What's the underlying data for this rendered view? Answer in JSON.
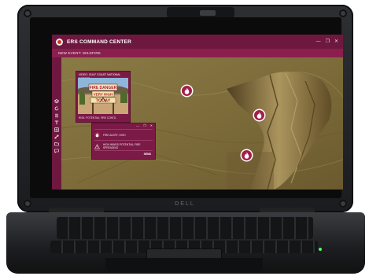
{
  "app": {
    "title": "ERS COMMAND CENTER",
    "event_label": "NEW EVENT: WILDFIRE",
    "window_controls": [
      "—",
      "❐",
      "✕"
    ]
  },
  "sidebar": {
    "icons": [
      "layers-icon",
      "refresh-icon",
      "list-icon",
      "text-icon",
      "grid-icon",
      "link-icon",
      "folder-icon",
      "chat-icon"
    ]
  },
  "video_card": {
    "title": "VIDEO: GULF COAST NATIONAL FOREST",
    "caption": "RISK: POTENTIAL FIRE CONTD."
  },
  "sign": {
    "line1": "FIRE DANGER",
    "line2": "VERY HIGH",
    "line3": "TODAY"
  },
  "alert": {
    "controls": [
      "—",
      "❐",
      "✕"
    ],
    "row1": "FIRE ALERT: HIGH",
    "row2": "HIGH WINDS POTENTIAL FIRE SPREADING",
    "send_label": "SEND"
  },
  "device": {
    "brand": "DELL"
  },
  "colors": {
    "titlebar": "#6e1840",
    "accent": "#8a1f4e",
    "pin": "#a01f4a"
  }
}
